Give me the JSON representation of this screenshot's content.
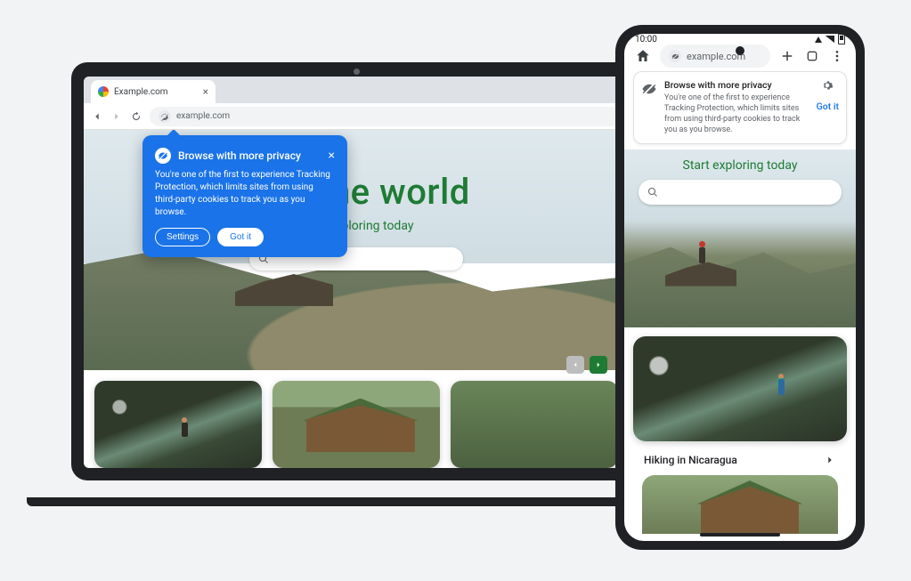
{
  "laptop": {
    "tab": {
      "title": "Example.com"
    },
    "toolbar": {
      "url": "example.com"
    },
    "popover": {
      "title": "Browse with more privacy",
      "body": "You're one of the first to experience Tracking Protection, which limits sites from using third-party cookies to track you as you browse.",
      "settings_label": "Settings",
      "gotit_label": "Got it"
    },
    "hero": {
      "headline": "avel the world",
      "subheadline": "Start exploring today"
    }
  },
  "phone": {
    "status": {
      "time": "10:00"
    },
    "toolbar": {
      "url": "example.com"
    },
    "notice": {
      "title": "Browse with more privacy",
      "body": "You're one of the first to experience Tracking Protection, which limits sites from using third-party cookies to track you as you browse.",
      "gotit_label": "Got it"
    },
    "hero": {
      "subheadline": "Start exploring today"
    },
    "card_row": {
      "title": "Hiking in Nicaragua"
    }
  }
}
